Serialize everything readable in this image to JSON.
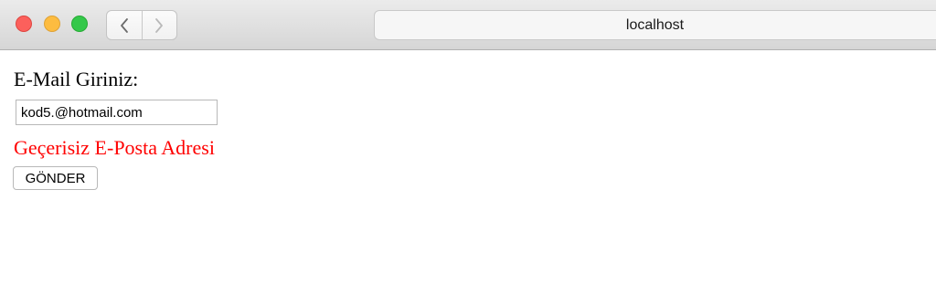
{
  "browser": {
    "address": "localhost",
    "controls": {
      "close": "close",
      "minimize": "minimize",
      "zoom": "zoom"
    },
    "nav_icons": {
      "back": "chevron-left-icon",
      "forward": "chevron-right-icon"
    },
    "colors": {
      "close": "#fc605c",
      "minimize": "#fdbc40",
      "zoom": "#34c84a"
    }
  },
  "form": {
    "label": "E-Mail Giriniz:",
    "email_value": "kod5.@hotmail.com",
    "error_message": "Geçerisiz E-Posta Adresi",
    "submit_label": "GÖNDER",
    "error_color": "#ff0000"
  }
}
